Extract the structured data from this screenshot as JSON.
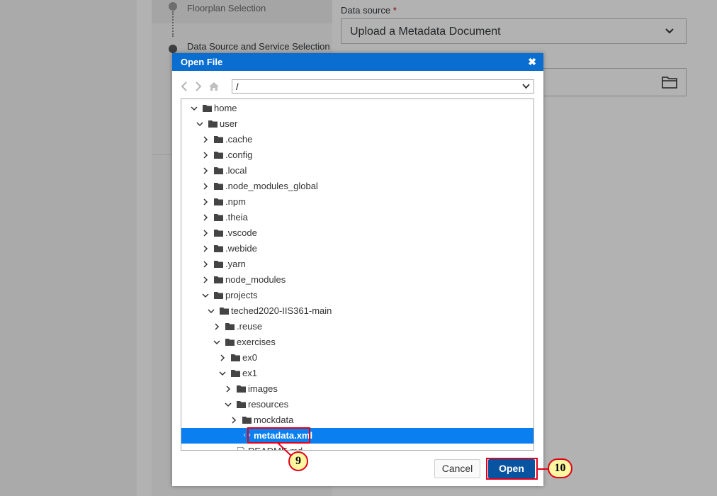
{
  "background": {
    "steps": [
      {
        "label": "Floorplan Selection"
      },
      {
        "label": "Data Source and Service Selection"
      }
    ],
    "data_source": {
      "label": "Data source",
      "required_mark": "*",
      "value": "Upload a Metadata Document"
    }
  },
  "dialog": {
    "title": "Open File",
    "close_glyph": "✖",
    "path": "/",
    "tree": [
      {
        "label": "home",
        "depth": 0,
        "expanded": true,
        "type": "folder"
      },
      {
        "label": "user",
        "depth": 1,
        "expanded": true,
        "type": "folder"
      },
      {
        "label": ".cache",
        "depth": 2,
        "expanded": false,
        "type": "folder"
      },
      {
        "label": ".config",
        "depth": 2,
        "expanded": false,
        "type": "folder"
      },
      {
        "label": ".local",
        "depth": 2,
        "expanded": false,
        "type": "folder"
      },
      {
        "label": ".node_modules_global",
        "depth": 2,
        "expanded": false,
        "type": "folder"
      },
      {
        "label": ".npm",
        "depth": 2,
        "expanded": false,
        "type": "folder"
      },
      {
        "label": ".theia",
        "depth": 2,
        "expanded": false,
        "type": "folder"
      },
      {
        "label": ".vscode",
        "depth": 2,
        "expanded": false,
        "type": "folder"
      },
      {
        "label": ".webide",
        "depth": 2,
        "expanded": false,
        "type": "folder"
      },
      {
        "label": ".yarn",
        "depth": 2,
        "expanded": false,
        "type": "folder"
      },
      {
        "label": "node_modules",
        "depth": 2,
        "expanded": false,
        "type": "folder"
      },
      {
        "label": "projects",
        "depth": 2,
        "expanded": true,
        "type": "folder"
      },
      {
        "label": "teched2020-IIS361-main",
        "depth": 3,
        "expanded": true,
        "type": "folder"
      },
      {
        "label": ".reuse",
        "depth": 4,
        "expanded": false,
        "type": "folder"
      },
      {
        "label": "exercises",
        "depth": 4,
        "expanded": true,
        "type": "folder"
      },
      {
        "label": "ex0",
        "depth": 5,
        "expanded": false,
        "type": "folder"
      },
      {
        "label": "ex1",
        "depth": 5,
        "expanded": true,
        "type": "folder"
      },
      {
        "label": "images",
        "depth": 6,
        "expanded": false,
        "type": "folder"
      },
      {
        "label": "resources",
        "depth": 6,
        "expanded": true,
        "type": "folder"
      },
      {
        "label": "mockdata",
        "depth": 7,
        "expanded": false,
        "type": "folder"
      },
      {
        "label": "metadata.xml",
        "depth": 7,
        "type": "xml",
        "selected": true
      },
      {
        "label": "README.md",
        "depth": 6,
        "type": "file"
      }
    ],
    "cancel_label": "Cancel",
    "open_label": "Open"
  },
  "callouts": {
    "selected_file_step": "9",
    "open_button_step": "10"
  },
  "colors": {
    "header": "#0a6ed1",
    "selection": "#0a7ff0",
    "primary_button": "#0854a0",
    "callout_border": "#e3001b",
    "callout_fill": "#fff8a0"
  }
}
